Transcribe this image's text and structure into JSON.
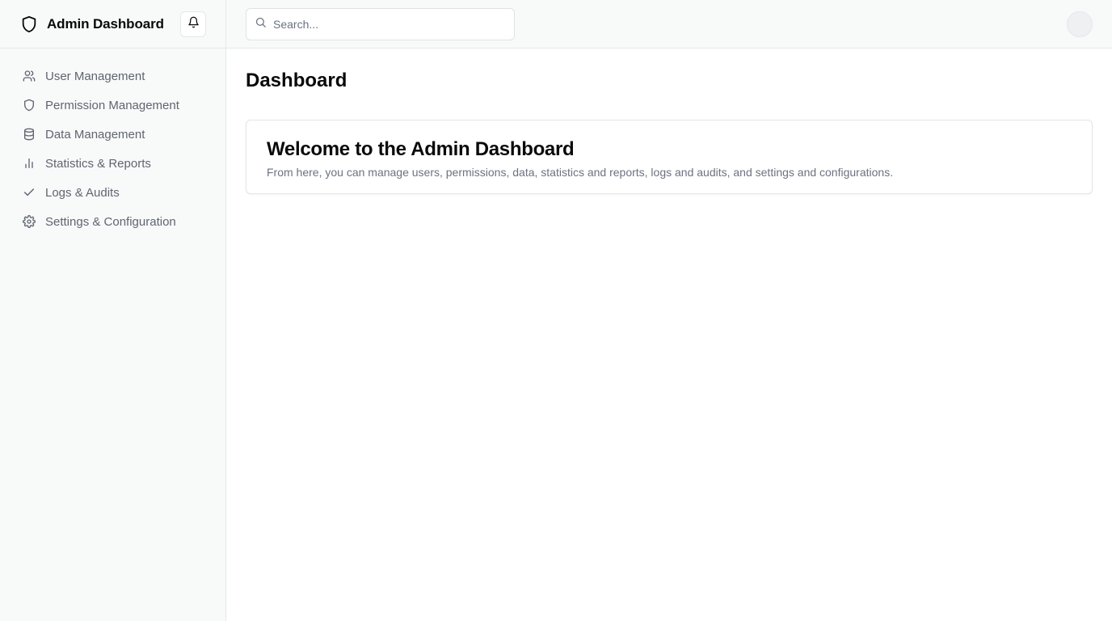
{
  "app": {
    "title": "Admin Dashboard"
  },
  "sidebar": {
    "items": [
      {
        "label": "User Management",
        "icon": "users-icon"
      },
      {
        "label": "Permission Management",
        "icon": "shield-icon"
      },
      {
        "label": "Data Management",
        "icon": "database-icon"
      },
      {
        "label": "Statistics & Reports",
        "icon": "bar-chart-icon"
      },
      {
        "label": "Logs & Audits",
        "icon": "check-icon"
      },
      {
        "label": "Settings & Configuration",
        "icon": "gear-icon"
      }
    ]
  },
  "header": {
    "search": {
      "placeholder": "Search...",
      "value": ""
    }
  },
  "main": {
    "page_title": "Dashboard",
    "welcome": {
      "title": "Welcome to the Admin Dashboard",
      "text": "From here, you can manage users, permissions, data, statistics and reports, logs and audits, and settings and configurations."
    }
  },
  "colors": {
    "sidebar_bg": "#f8f9f9",
    "border": "#e5e7eb",
    "muted_text": "#6b7280",
    "nav_text": "#5f6570",
    "heading": "#0a0a0a"
  }
}
